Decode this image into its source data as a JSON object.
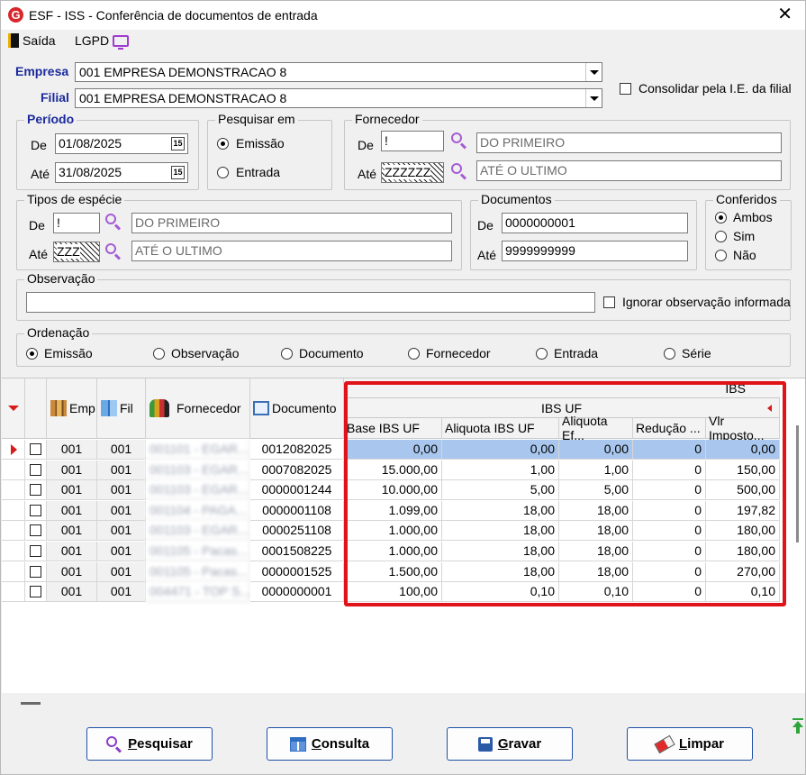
{
  "window": {
    "title": "ESF - ISS - Conferência de documentos de entrada",
    "close_glyph": "✕",
    "logo_glyph": "G"
  },
  "toolbar": {
    "exit_label": "Saída",
    "lgpd_label": "LGPD"
  },
  "empresa": {
    "label": "Empresa",
    "value": "001 EMPRESA DEMONSTRACAO 8"
  },
  "filial": {
    "label": "Filial",
    "value": "001 EMPRESA DEMONSTRACAO 8"
  },
  "consolidar": {
    "label": "Consolidar pela I.E. da filial",
    "checked": false
  },
  "periodo": {
    "title": "Período",
    "de_label": "De",
    "de_value": "01/08/2025",
    "ate_label": "Até",
    "ate_value": "31/08/2025",
    "cal_glyph": "15"
  },
  "pesquisar_em": {
    "title": "Pesquisar em",
    "options": [
      "Emissão",
      "Entrada"
    ],
    "selected": "Emissão"
  },
  "fornecedor": {
    "title": "Fornecedor",
    "de_label": "De",
    "de_code": "!",
    "de_name": "DO PRIMEIRO",
    "ate_label": "Até",
    "ate_code": "ZZZZZZ",
    "ate_name": "ATÉ O ULTIMO"
  },
  "tipos_especie": {
    "title": "Tipos de espécie",
    "de_label": "De",
    "de_code": "!",
    "de_name": "DO PRIMEIRO",
    "ate_label": "Até",
    "ate_code": "ZZZ",
    "ate_name": "ATÉ O ULTIMO"
  },
  "documentos": {
    "title": "Documentos",
    "de_label": "De",
    "de_value": "0000000001",
    "ate_label": "Até",
    "ate_value": "9999999999"
  },
  "conferidos": {
    "title": "Conferidos",
    "options": [
      "Ambos",
      "Sim",
      "Não"
    ],
    "selected": "Ambos"
  },
  "observacao": {
    "title": "Observação",
    "value": "",
    "ignore_label": "Ignorar observação informada",
    "ignore_checked": false
  },
  "ordenacao": {
    "title": "Ordenação",
    "options": [
      "Emissão",
      "Observação",
      "Documento",
      "Fornecedor",
      "Entrada",
      "Série"
    ],
    "selected": "Emissão"
  },
  "grid": {
    "headers": {
      "emp": "Emp",
      "fil": "Fil",
      "fornecedor": "Fornecedor",
      "documento": "Documento"
    },
    "band_top": "IBS",
    "band_group": "IBS UF",
    "sub_headers": [
      "Base IBS UF",
      "Aliquota IBS UF",
      "Aliquota Ef...",
      "Redução ...",
      "Vlr Imposto..."
    ],
    "rows": [
      {
        "emp": "001",
        "fil": "001",
        "fornecedor": "001101 - EGAR...",
        "documento": "0012082025",
        "base": "0,00",
        "aliq": "0,00",
        "aliq_ef": "0,00",
        "reducao": "0",
        "vlr": "0,00"
      },
      {
        "emp": "001",
        "fil": "001",
        "fornecedor": "001103 - EGAR...",
        "documento": "0007082025",
        "base": "15.000,00",
        "aliq": "1,00",
        "aliq_ef": "1,00",
        "reducao": "0",
        "vlr": "150,00"
      },
      {
        "emp": "001",
        "fil": "001",
        "fornecedor": "001103 - EGAR...",
        "documento": "0000001244",
        "base": "10.000,00",
        "aliq": "5,00",
        "aliq_ef": "5,00",
        "reducao": "0",
        "vlr": "500,00"
      },
      {
        "emp": "001",
        "fil": "001",
        "fornecedor": "001104 - PAGA...",
        "documento": "0000001108",
        "base": "1.099,00",
        "aliq": "18,00",
        "aliq_ef": "18,00",
        "reducao": "0",
        "vlr": "197,82"
      },
      {
        "emp": "001",
        "fil": "001",
        "fornecedor": "001103 - EGAR...",
        "documento": "0000251108",
        "base": "1.000,00",
        "aliq": "18,00",
        "aliq_ef": "18,00",
        "reducao": "0",
        "vlr": "180,00"
      },
      {
        "emp": "001",
        "fil": "001",
        "fornecedor": "001105 - Pacas...",
        "documento": "0001508225",
        "base": "1.000,00",
        "aliq": "18,00",
        "aliq_ef": "18,00",
        "reducao": "0",
        "vlr": "180,00"
      },
      {
        "emp": "001",
        "fil": "001",
        "fornecedor": "001105 - Pacas...",
        "documento": "0000001525",
        "base": "1.500,00",
        "aliq": "18,00",
        "aliq_ef": "18,00",
        "reducao": "0",
        "vlr": "270,00"
      },
      {
        "emp": "001",
        "fil": "001",
        "fornecedor": "004471 - TOP S...",
        "documento": "0000000001",
        "base": "100,00",
        "aliq": "0,10",
        "aliq_ef": "0,10",
        "reducao": "0",
        "vlr": "0,10"
      }
    ]
  },
  "buttons": {
    "pesquisar": {
      "accel": "P",
      "rest": "esquisar"
    },
    "consulta": {
      "accel": "C",
      "rest": "onsulta"
    },
    "gravar": {
      "accel": "G",
      "rest": "ravar"
    },
    "limpar": {
      "accel": "L",
      "rest": "impar"
    }
  },
  "colors": {
    "accent_blue": "#1a2a9c",
    "highlight_red": "#e0131a",
    "selected_row": "#a9c7ee",
    "search_purple": "#a45bd4"
  }
}
